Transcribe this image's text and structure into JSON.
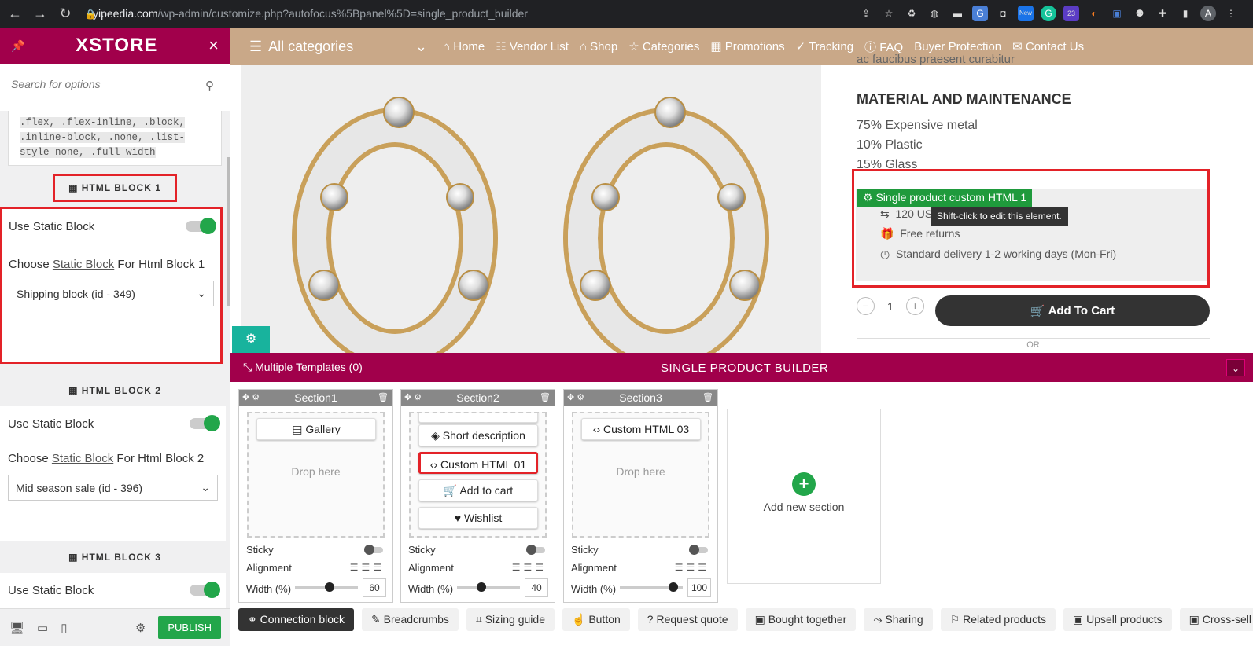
{
  "browser": {
    "url_domain": "yipeedia.com",
    "url_path": "/wp-admin/customize.php?autofocus%5Bpanel%5D=single_product_builder",
    "extension_badges": [
      "New",
      "23"
    ]
  },
  "left_panel": {
    "logo": "XSTORE",
    "close": "×",
    "search_placeholder": "Search for options",
    "classes_text": ".flex, .flex-inline, .block, .inline-block, .none, .list-style-none, .full-width",
    "blocks": [
      {
        "title": "HTML BLOCK 1",
        "use_static": "Use Static Block",
        "choose_prefix": "Choose ",
        "choose_link": "Static Block",
        "choose_suffix": " For Html Block 1",
        "selected": "Shipping block (id - 349)"
      },
      {
        "title": "HTML BLOCK 2",
        "use_static": "Use Static Block",
        "choose_prefix": "Choose ",
        "choose_link": "Static Block",
        "choose_suffix": " For Html Block 2",
        "selected": "Mid season sale (id - 396)"
      },
      {
        "title": "HTML BLOCK 3",
        "use_static": "Use Static Block"
      }
    ],
    "publish": "PUBLISH"
  },
  "site": {
    "all_categories": "All categories",
    "menu": [
      "Home",
      "Vendor List",
      "Shop",
      "Categories",
      "Promotions",
      "Tracking",
      "FAQ",
      "Buyer Protection",
      "Contact Us"
    ],
    "cut_text": "ac faucibus praesent curabitur",
    "material_heading": "MATERIAL AND MAINTENANCE",
    "materials": [
      "75% Expensive metal",
      "10% Plastic",
      "15% Glass"
    ],
    "html_label": "Single product custom HTML 1",
    "ship_lines": [
      "120 US",
      "Free returns",
      "Standard delivery 1-2 working days (Mon-Fri)"
    ],
    "tooltip": "Shift-click to edit this element.",
    "qty": "1",
    "add_to_cart": "Add To Cart",
    "or": "OR"
  },
  "builder": {
    "templates": "Multiple Templates (0)",
    "title": "SINGLE PRODUCT BUILDER",
    "sections": [
      {
        "name": "Section1",
        "elements": [
          "Gallery"
        ],
        "drop": "Drop here",
        "width": "60"
      },
      {
        "name": "Section2",
        "elements": [
          "Short description",
          "Custom HTML 01",
          "Add to cart",
          "Wishlist"
        ],
        "width": "40"
      },
      {
        "name": "Section3",
        "elements": [
          "Custom HTML 03"
        ],
        "drop": "Drop here",
        "width": "100"
      }
    ],
    "sticky_label": "Sticky",
    "alignment_label": "Alignment",
    "width_label": "Width (%)",
    "add_section": "Add new section",
    "tabs": [
      "Connection block",
      "Breadcrumbs",
      "Sizing guide",
      "Button",
      "Request quote",
      "Bought together",
      "Sharing",
      "Related products",
      "Upsell products",
      "Cross-sell"
    ]
  }
}
